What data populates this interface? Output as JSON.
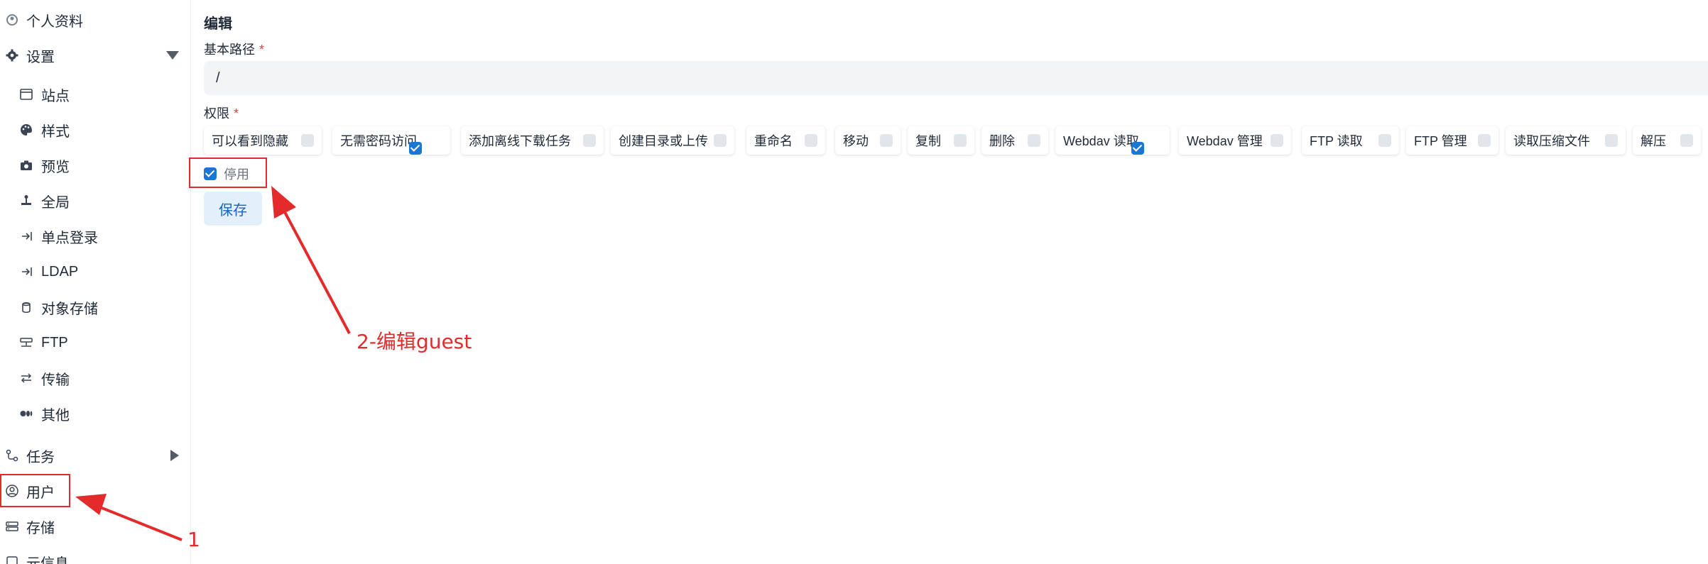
{
  "sidebar": {
    "profile": "个人资料",
    "settings": "设置",
    "sub_items": {
      "site": "站点",
      "style": "样式",
      "preview": "预览",
      "global": "全局",
      "sso": "单点登录",
      "ldap": "LDAP",
      "object_storage": "对象存储",
      "ftp": "FTP",
      "transfer": "传输",
      "other": "其他"
    },
    "tasks": "任务",
    "users": "用户",
    "storage": "存储",
    "meta": "元信息"
  },
  "form": {
    "title": "编辑",
    "base_path_label": "基本路径",
    "required_mark": "*",
    "base_path_value": "/",
    "permissions_label": "权限",
    "permissions": [
      {
        "label": "可以看到隐藏",
        "checked": false
      },
      {
        "label": "无需密码访问",
        "checked": true
      },
      {
        "label": "添加离线下载任务",
        "checked": false
      },
      {
        "label": "创建目录或上传",
        "checked": false
      },
      {
        "label": "重命名",
        "checked": false
      },
      {
        "label": "移动",
        "checked": false
      },
      {
        "label": "复制",
        "checked": false
      },
      {
        "label": "删除",
        "checked": false
      },
      {
        "label": "Webdav 读取",
        "checked": true
      },
      {
        "label": "Webdav 管理",
        "checked": false
      },
      {
        "label": "FTP 读取",
        "checked": false
      },
      {
        "label": "FTP 管理",
        "checked": false
      },
      {
        "label": "读取压缩文件",
        "checked": false
      },
      {
        "label": "解压",
        "checked": false
      }
    ],
    "disable_label": "停用",
    "disable_checked": true,
    "save_label": "保存"
  },
  "annotations": {
    "step1": "1",
    "step2": "2-编辑guest",
    "color": "#e32b2b"
  }
}
